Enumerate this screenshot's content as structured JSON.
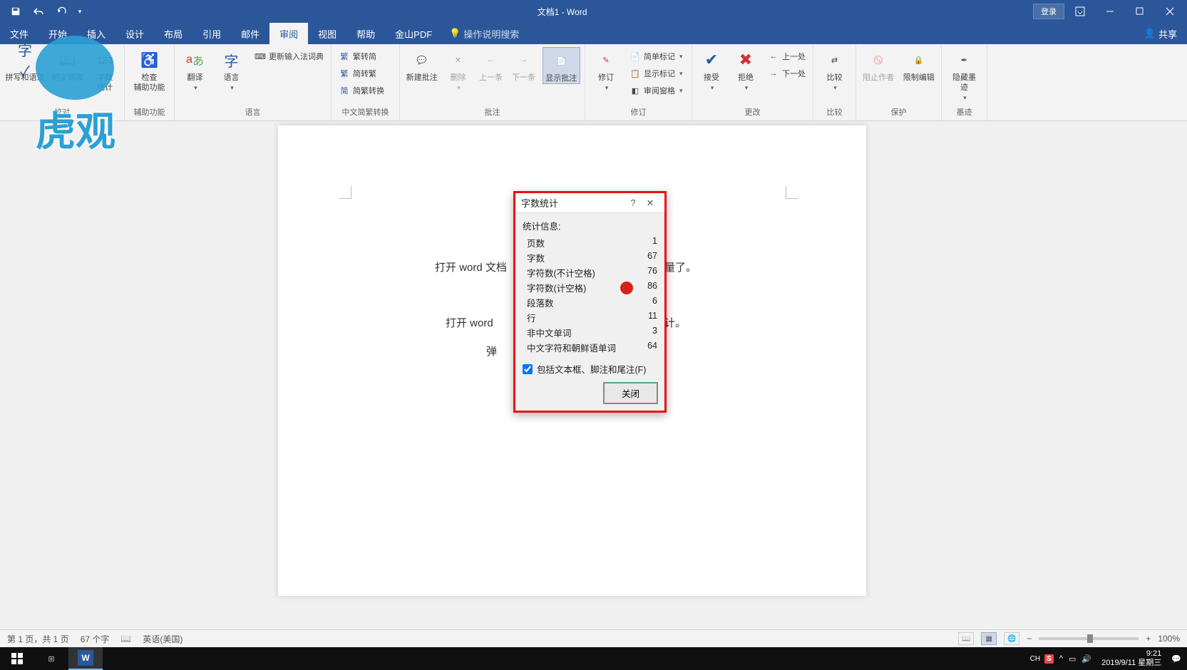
{
  "titlebar": {
    "title": "文档1 - Word",
    "login": "登录"
  },
  "tabs": {
    "file": "文件",
    "start": "开始",
    "insert": "插入",
    "design": "设计",
    "layout": "布局",
    "reference": "引用",
    "mail": "邮件",
    "review": "审阅",
    "view": "视图",
    "help": "帮助",
    "wps": "金山PDF",
    "tellme": "操作说明搜索",
    "share": "共享"
  },
  "ribbon": {
    "proofing": {
      "spell": "拼写和语法",
      "thesaurus": "同义词库",
      "count": "字数\n统计",
      "a11y": "检查\n辅助功能",
      "group": "辅助功能"
    },
    "language": {
      "translate": "翻译",
      "lang": "语言",
      "ime": "更新输入法词典",
      "group": "语言"
    },
    "sc": {
      "s2t": "繁转简",
      "t2s": "简转繁",
      "conv": "简繁转换",
      "group": "中文简繁转换"
    },
    "comments": {
      "new": "新建批注",
      "del": "删除",
      "prev": "上一条",
      "next": "下一条",
      "show": "显示批注",
      "group": "批注"
    },
    "track": {
      "track": "修订",
      "simple": "简单标记",
      "markup": "显示标记",
      "pane": "审阅窗格",
      "group": "修订"
    },
    "changes": {
      "accept": "接受",
      "reject": "拒绝",
      "prev": "上一处",
      "next": "下一处",
      "group": "更改"
    },
    "compare": {
      "compare": "比较",
      "group": "比较"
    },
    "protect": {
      "block": "阻止作者",
      "restrict": "限制编辑",
      "group": "保护"
    },
    "ink": {
      "hide": "隐藏墨\n迹",
      "group": "墨迹"
    }
  },
  "doc": {
    "line1_left": "打开 word 文档",
    "line1_right": "字数数量了。",
    "line2_left": "打开 word",
    "line2_right": "字数统计。",
    "line3": "弹"
  },
  "dialog": {
    "title": "字数统计",
    "heading": "统计信息:",
    "rows": [
      {
        "label": "页数",
        "value": "1"
      },
      {
        "label": "字数",
        "value": "67"
      },
      {
        "label": "字符数(不计空格)",
        "value": "76"
      },
      {
        "label": "字符数(计空格)",
        "value": "86"
      },
      {
        "label": "段落数",
        "value": "6"
      },
      {
        "label": "行",
        "value": "11"
      },
      {
        "label": "非中文单词",
        "value": "3"
      },
      {
        "label": "中文字符和朝鲜语单词",
        "value": "64"
      }
    ],
    "checkbox": "包括文本框、脚注和尾注(F)",
    "close": "关闭"
  },
  "status": {
    "page": "第 1 页，共 1 页",
    "words": "67 个字",
    "lang": "英语(美国)",
    "zoom": "100%"
  },
  "taskbar": {
    "ime": "CH",
    "time": "9:21",
    "date": "2019/9/11 星期三"
  },
  "watermark": "虎观"
}
